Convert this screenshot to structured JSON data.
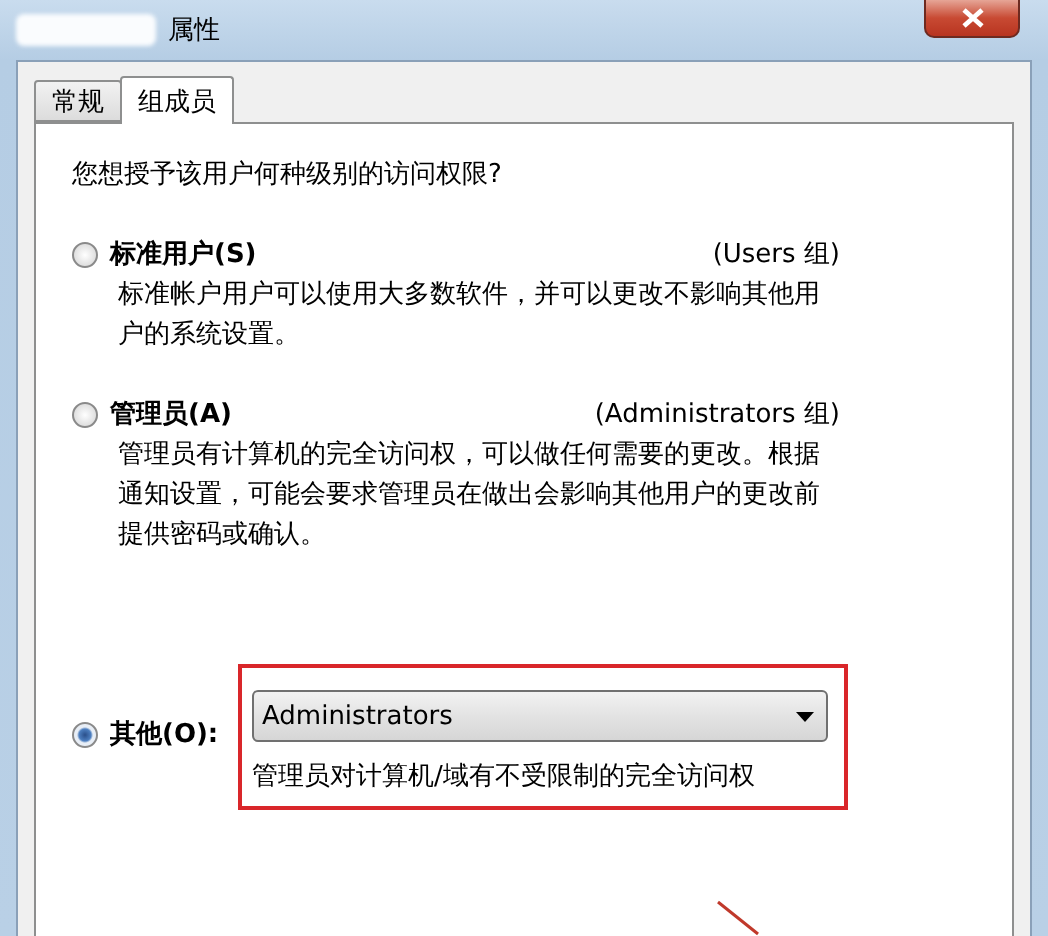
{
  "window": {
    "title": "属性"
  },
  "tabs": [
    {
      "label": "常规",
      "selected": false
    },
    {
      "label": "组成员",
      "selected": true
    }
  ],
  "question": "您想授予该用户何种级别的访问权限?",
  "options": [
    {
      "kind": "group",
      "label": "标准用户(S)",
      "group": "(Users 组)",
      "description": "标准帐户用户可以使用大多数软件，并可以更改不影响其他用户的系统设置。",
      "selected": false
    },
    {
      "kind": "group",
      "label": "管理员(A)",
      "group": "(Administrators 组)",
      "description": "管理员有计算机的完全访问权，可以做任何需要的更改。根据通知设置，可能会要求管理员在做出会影响其他用户的更改前提供密码或确认。",
      "selected": false
    },
    {
      "kind": "dropdown",
      "label": "其他(O):",
      "value": "Administrators",
      "description": "管理员对计算机/域有不受限制的完全访问权",
      "selected": true
    }
  ]
}
